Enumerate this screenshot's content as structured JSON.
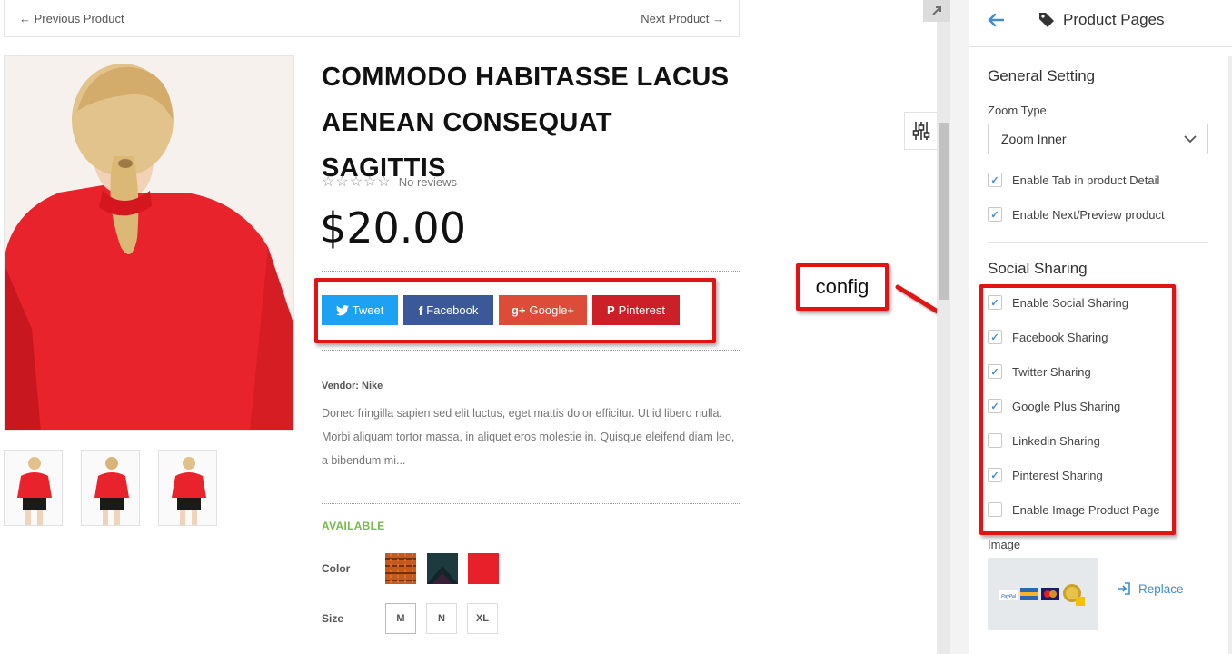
{
  "product_nav": {
    "previous": "← Previous Product",
    "next": "Next Product →"
  },
  "product": {
    "title_line1": "COMMODO HABITASSE LACUS",
    "title_line2": "AENEAN CONSEQUAT SAGITTIS",
    "stars": "☆☆☆☆☆",
    "rating": 0,
    "reviews_text": "No reviews",
    "price": "$20.00",
    "vendor": "Vendor: Nike",
    "description": "Donec fringilla sapien sed elit luctus, eget mattis dolor efficitur. Ut id libero nulla. Morbi aliquam tortor massa, in aliquet eros molestie in. Quisque eleifend diam leo, a bibendum mi...",
    "availability": "AVAILABLE",
    "color_label": "Color",
    "size_label": "Size",
    "sizes": [
      "M",
      "N",
      "XL"
    ],
    "colors": [
      "#c55a1d",
      "#1d3a3f",
      "#e8202a"
    ]
  },
  "share_buttons": [
    {
      "label": "Tweet",
      "icon": "twitter-icon",
      "glyph": "🐦",
      "color": "#1da1f2"
    },
    {
      "label": "Facebook",
      "icon": "facebook-icon",
      "glyph": "f",
      "color": "#3b5998"
    },
    {
      "label": "Google+",
      "icon": "google-plus-icon",
      "glyph": "g+",
      "color": "#dd4b39"
    },
    {
      "label": "Pinterest",
      "icon": "pinterest-icon",
      "glyph": "P",
      "color": "#cb2027"
    }
  ],
  "annotation": {
    "label": "config"
  },
  "panel": {
    "title": "Product Pages",
    "general_title": "General Setting",
    "zoom_label": "Zoom Type",
    "zoom_value": "Zoom Inner",
    "general_checks": [
      {
        "label": "Enable Tab in product Detail",
        "checked": true
      },
      {
        "label": "Enable Next/Preview product",
        "checked": true
      }
    ],
    "social_title": "Social Sharing",
    "social_checks": [
      {
        "label": "Enable Social Sharing",
        "checked": true
      },
      {
        "label": "Facebook Sharing",
        "checked": true
      },
      {
        "label": "Twitter Sharing",
        "checked": true
      },
      {
        "label": "Google Plus Sharing",
        "checked": true
      },
      {
        "label": "Linkedin Sharing",
        "checked": false
      },
      {
        "label": "Pinterest Sharing",
        "checked": true
      },
      {
        "label": "Enable Image Product Page",
        "checked": false
      }
    ],
    "image_label": "Image",
    "replace_label": "Replace"
  },
  "colors": {
    "accent_blue": "#3e8ed0",
    "annotation_red": "#e01414",
    "available_green": "#79b94e"
  }
}
